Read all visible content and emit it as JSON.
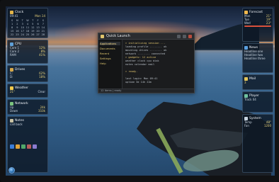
{
  "window": {
    "title": "Quick Launch",
    "nav": [
      "Applications",
      "Documents",
      "Recent",
      "Settings",
      "Help"
    ],
    "lines": [
      "> initializing session ...",
      "  loading profile ........ ok",
      "  mounting drives ........ ok",
      "  network ........ connected",
      "> gadgets: 12 active",
      "  weather  clock  cpu  disk",
      "  notes  calendar  mail",
      "",
      "> ready.",
      "",
      "  last login: Mon 09:41",
      "  uptime 3d 14h 22m"
    ],
    "status": "12 items  |  ready"
  },
  "left": {
    "clock": {
      "title": "Clock",
      "time": "09:41",
      "date": "Mon 14"
    },
    "calendar": {
      "title": "Calendar",
      "days": [
        "S",
        "M",
        "T",
        "W",
        "T",
        "F",
        "S",
        "1",
        "2",
        "3",
        "4",
        "5",
        "6",
        "7",
        "8",
        "9",
        "10",
        "11",
        "12",
        "13",
        "14",
        "15",
        "16",
        "17",
        "18",
        "19",
        "20",
        "21",
        "22",
        "23",
        "24",
        "25",
        "26",
        "27",
        "28"
      ]
    },
    "cpu": {
      "title": "CPU",
      "rows": [
        [
          "Core 1",
          "12%"
        ],
        [
          "Core 2",
          "8%"
        ],
        [
          "RAM",
          "41%"
        ]
      ]
    },
    "disk": {
      "title": "Drives",
      "rows": [
        [
          "C:",
          "62%"
        ],
        [
          "D:",
          "18%"
        ]
      ]
    },
    "weather": {
      "title": "Weather",
      "temp": "21°",
      "cond": "Clear"
    },
    "net": {
      "title": "Network",
      "rows": [
        [
          "Up",
          "24k"
        ],
        [
          "Down",
          "310k"
        ]
      ]
    },
    "notes": {
      "title": "Notes",
      "text": "call back"
    }
  },
  "right": {
    "weather": {
      "title": "Forecast",
      "rows": [
        [
          "Mon",
          "21°"
        ],
        [
          "Tue",
          "19°"
        ],
        [
          "Wed",
          "23°"
        ]
      ]
    },
    "feed": {
      "title": "News",
      "rows": [
        "Headline one",
        "Headline two",
        "Headline three"
      ]
    },
    "mail": {
      "title": "Mail",
      "count": "3"
    },
    "media": {
      "title": "Player",
      "track": "Track 04"
    },
    "stats": {
      "title": "System",
      "rows": [
        [
          "Temp",
          "48°"
        ],
        [
          "Fan",
          "1200"
        ]
      ]
    }
  },
  "colors": {
    "accent": "#e8d27a",
    "window_bg": "#1b1c1e",
    "gadget_bg": "#0e1826"
  },
  "icons": {
    "start": "start-orb-icon",
    "close": "close-icon",
    "minimize": "minimize-icon",
    "maximize": "maximize-icon"
  }
}
